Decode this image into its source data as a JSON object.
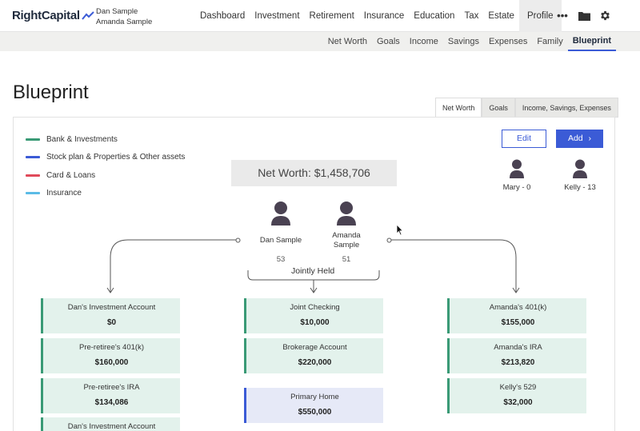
{
  "app": {
    "brand": "RightCapital",
    "users": [
      "Dan Sample",
      "Amanda Sample"
    ]
  },
  "nav": {
    "items": [
      "Dashboard",
      "Investment",
      "Retirement",
      "Insurance",
      "Education",
      "Tax",
      "Estate",
      "Profile"
    ],
    "active": "Profile",
    "more": "•••"
  },
  "subnav": {
    "items": [
      "Net Worth",
      "Goals",
      "Income",
      "Savings",
      "Expenses",
      "Family",
      "Blueprint"
    ],
    "active": "Blueprint"
  },
  "page": {
    "title": "Blueprint"
  },
  "view_tabs": {
    "items": [
      "Net Worth",
      "Goals",
      "Income, Savings, Expenses"
    ],
    "active": "Net Worth"
  },
  "legend": [
    {
      "label": "Bank & Investments",
      "color": "#3a9a76"
    },
    {
      "label": "Stock plan & Properties & Other assets",
      "color": "#3b5bd6"
    },
    {
      "label": "Card & Loans",
      "color": "#e04a5a"
    },
    {
      "label": "Insurance",
      "color": "#5bbbe6"
    }
  ],
  "actions": {
    "edit": "Edit",
    "add": "Add"
  },
  "net_worth": "Net Worth: $1,458,706",
  "clients": [
    {
      "name": "Dan Sample",
      "age": "53"
    },
    {
      "name": "Amanda\nSample",
      "age": "51"
    }
  ],
  "dependents": [
    {
      "label": "Mary - 0"
    },
    {
      "label": "Kelly - 13"
    }
  ],
  "joint_label": "Jointly Held",
  "accounts": {
    "left": [
      {
        "name": "Dan's Investment Account",
        "value": "$0"
      },
      {
        "name": "Pre-retiree's 401(k)",
        "value": "$160,000"
      },
      {
        "name": "Pre-retiree's IRA",
        "value": "$134,086"
      },
      {
        "name": "Dan's Investment Account",
        "value": ""
      }
    ],
    "center": [
      {
        "name": "Joint Checking",
        "value": "$10,000"
      },
      {
        "name": "Brokerage Account",
        "value": "$220,000"
      },
      {
        "name": "Primary Home",
        "value": "$550,000"
      }
    ],
    "right": [
      {
        "name": "Amanda's 401(k)",
        "value": "$155,000"
      },
      {
        "name": "Amanda's IRA",
        "value": "$213,820"
      },
      {
        "name": "Kelly's 529",
        "value": "$32,000"
      }
    ]
  },
  "colors": {
    "accent": "#3b5bd6",
    "bank": "#3a9a76",
    "person": "#4a4252"
  }
}
